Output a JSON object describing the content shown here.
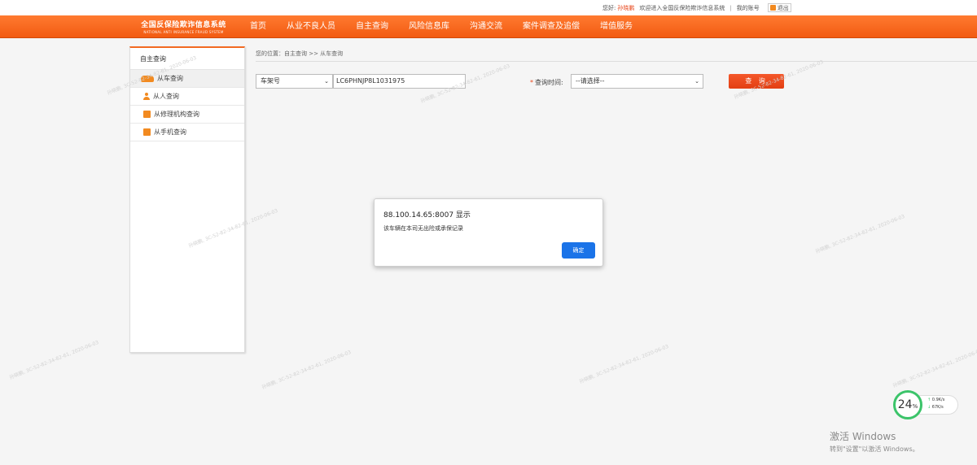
{
  "topbar": {
    "greeting": "您好:",
    "username": "孙晓鹏",
    "welcome": "欢迎进入全国反保险欺诈信息系统",
    "sep": "|",
    "my_account": "我的账号",
    "logout": "退出"
  },
  "logo": {
    "title_cn": "全国反保险欺诈信息系统",
    "title_en": "NATIONAL ANTI INSURANCE FRAUD SYSTEM"
  },
  "nav": {
    "items": [
      "首页",
      "从业不良人员",
      "自主查询",
      "风险信息库",
      "沟通交流",
      "案件调查及追偿",
      "增值服务"
    ]
  },
  "sidebar": {
    "header": "自主查询",
    "items": [
      "从车查询",
      "从人查询",
      "从修理机构查询",
      "从手机查询"
    ]
  },
  "main": {
    "breadcrumb": "您的位置：自主查询 >> 从车查询",
    "field_type": "车架号",
    "vin_value": "LC6PHNJP8L1031975",
    "query_time_label": "查询时间:",
    "query_time_required": "*",
    "query_time_value": "--请选择--",
    "query_button": "查 询"
  },
  "dialog": {
    "title": "88.100.14.65:8007 显示",
    "message": "该车辆在本司无出险或承保记录",
    "ok": "确定"
  },
  "netwidget": {
    "percent": "24",
    "percent_sign": "%",
    "up": "0.9K/s",
    "down": "67K/s"
  },
  "windows": {
    "line1": "激活 Windows",
    "line2": "转到\"设置\"以激活 Windows。"
  },
  "watermark": "孙晓鹏, 3C-52-82-34-82-61, 2020-06-03",
  "colors": {
    "brand_orange": "#f26a22",
    "dialog_button": "#1a73e8",
    "progress_green": "#3cc46a"
  }
}
